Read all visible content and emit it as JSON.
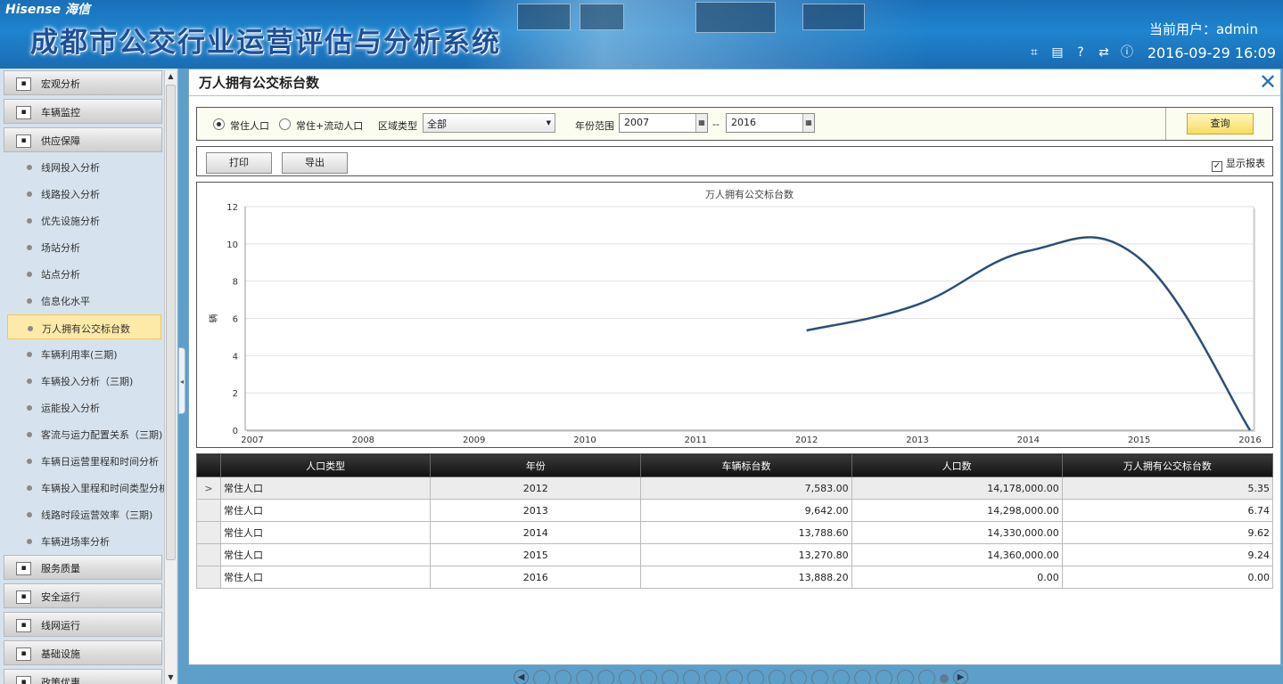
{
  "header": {
    "brand": "Hisense 海信",
    "system_title": "成都市公交行业运营评估与分析系统",
    "current_user": "当前用户：admin",
    "datetime": "2016-09-29 16:09",
    "icons": [
      "crop-icon",
      "keyboard-icon",
      "help-icon",
      "refresh-icon",
      "info-icon"
    ]
  },
  "sidebar": {
    "categories": [
      {
        "label": "宏观分析",
        "icon": "chart-icon"
      },
      {
        "label": "车辆监控",
        "icon": "monitor-icon"
      },
      {
        "label": "供应保障",
        "icon": "supply-icon"
      },
      {
        "label": "服务质量",
        "icon": "service-icon"
      },
      {
        "label": "安全运行",
        "icon": "safety-icon"
      },
      {
        "label": "线网运行",
        "icon": "network-icon"
      },
      {
        "label": "基础设施",
        "icon": "infrastructure-icon"
      },
      {
        "label": "政策优惠",
        "icon": "policy-icon"
      }
    ],
    "items": [
      "线网投入分析",
      "线路投入分析",
      "优先设施分析",
      "场站分析",
      "站点分析",
      "信息化水平",
      "万人拥有公交标台数",
      "车辆利用率(三期)",
      "车辆投入分析（三期)",
      "运能投入分析",
      "客流与运力配置关系（三期)",
      "车辆日运营里程和时间分析",
      "车辆投入里程和时间类型分析",
      "线路时段运营效率（三期)",
      "车辆进场率分析"
    ],
    "active_item": "万人拥有公交标台数"
  },
  "main": {
    "title": "万人拥有公交标台数",
    "filter": {
      "radio1": "常住人口",
      "radio2": "常住+流动人口",
      "selected_radio": "常住人口",
      "region_label": "区域类型",
      "region_value": "全部",
      "year_label": "年份范围",
      "year_from": "2007",
      "year_sep": "--",
      "year_to": "2016",
      "query": "查询"
    },
    "toolbar": {
      "print": "打印",
      "export": "导出",
      "show_report": "显示报表",
      "show_report_checked": true
    }
  },
  "chart_data": {
    "type": "line",
    "title": "万人拥有公交标台数",
    "ylabel": "辆",
    "xlabel": "",
    "x": [
      "2007",
      "2008",
      "2009",
      "2010",
      "2011",
      "2012",
      "2013",
      "2014",
      "2015",
      "2016"
    ],
    "ylim": [
      0,
      12
    ],
    "yticks": [
      0,
      2,
      4,
      6,
      8,
      10,
      12
    ],
    "series": [
      {
        "values": [
          null,
          null,
          null,
          null,
          null,
          5.35,
          6.74,
          9.62,
          9.24,
          0.0
        ],
        "color": "#2a4f79"
      }
    ],
    "smooth": true,
    "grid": true
  },
  "table": {
    "headers": [
      "人口类型",
      "年份",
      "车辆标台数",
      "人口数",
      "万人拥有公交标台数"
    ],
    "current_row_marker": ">",
    "rows": [
      [
        "常住人口",
        "2012",
        "7,583.00",
        "14,178,000.00",
        "5.35"
      ],
      [
        "常住人口",
        "2013",
        "9,642.00",
        "14,298,000.00",
        "6.74"
      ],
      [
        "常住人口",
        "2014",
        "13,788.60",
        "14,330,000.00",
        "9.62"
      ],
      [
        "常住人口",
        "2015",
        "13,270.80",
        "14,360,000.00",
        "9.24"
      ],
      [
        "常住人口",
        "2016",
        "13,888.20",
        "0.00",
        "0.00"
      ]
    ]
  },
  "pager": {
    "pages": 19,
    "current": 20
  }
}
